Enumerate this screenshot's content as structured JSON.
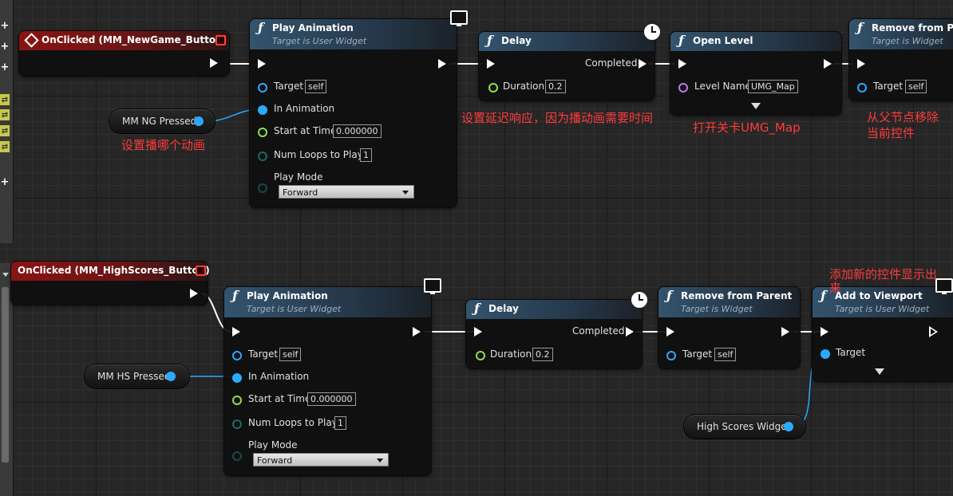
{
  "nodes": {
    "ng_event": {
      "title": "OnClicked (MM_NewGame_Button)"
    },
    "ng_play": {
      "title": "Play Animation",
      "subtitle": "Target is User Widget",
      "target_label": "Target",
      "target_value": "self",
      "anim_label": "In Animation",
      "start_label": "Start at Time",
      "start_value": "0.000000",
      "loops_label": "Num Loops to Play",
      "loops_value": "1",
      "mode_label": "Play Mode",
      "mode_value": "Forward"
    },
    "ng_delay": {
      "title": "Delay",
      "completed_label": "Completed",
      "duration_label": "Duration",
      "duration_value": "0.2"
    },
    "ng_open": {
      "title": "Open Level",
      "level_label": "Level Name",
      "level_value": "UMG_Map"
    },
    "ng_remove": {
      "title": "Remove from Par",
      "subtitle": "Target is Widget",
      "target_label": "Target",
      "target_value": "self"
    },
    "ng_var": {
      "label": "MM NG Pressed"
    },
    "hs_event": {
      "title": "OnClicked (MM_HighScores_Button)"
    },
    "hs_play": {
      "title": "Play Animation",
      "subtitle": "Target is User Widget",
      "target_label": "Target",
      "target_value": "self",
      "anim_label": "In Animation",
      "start_label": "Start at Time",
      "start_value": "0.000000",
      "loops_label": "Num Loops to Play",
      "loops_value": "1",
      "mode_label": "Play Mode",
      "mode_value": "Forward"
    },
    "hs_delay": {
      "title": "Delay",
      "completed_label": "Completed",
      "duration_label": "Duration",
      "duration_value": "0.2"
    },
    "hs_remove": {
      "title": "Remove from Parent",
      "subtitle": "Target is Widget",
      "target_label": "Target",
      "target_value": "self"
    },
    "hs_add": {
      "title": "Add to Viewport",
      "subtitle": "Target is User Widget",
      "target_label": "Target"
    },
    "hs_var": {
      "label": "MM HS Pressed"
    },
    "hs_widget_var": {
      "label": "High Scores Widget"
    }
  },
  "annotations": {
    "which_anim": "设置播哪个动画",
    "delay_note": "设置延迟响应，因为播动画需要时间",
    "open_note": "打开关卡UMG_Map",
    "remove_note_1": "从父节点移除",
    "remove_note_2": "当前控件",
    "add_note_1": "添加新的控件显示出",
    "add_note_2": "来"
  },
  "icons": [
    "function-icon",
    "event-diamond-icon",
    "clock-icon",
    "monitor-icon",
    "exec-pin-icon",
    "data-pin-icon",
    "expand-arrow-icon"
  ],
  "colors": {
    "event_header": "#8a1414",
    "func_header": "#33546e",
    "object_pin": "#2aa9ff",
    "float_pin": "#8fe04a",
    "name_pin": "#c27ae8",
    "annotation": "#ff3b3b"
  }
}
